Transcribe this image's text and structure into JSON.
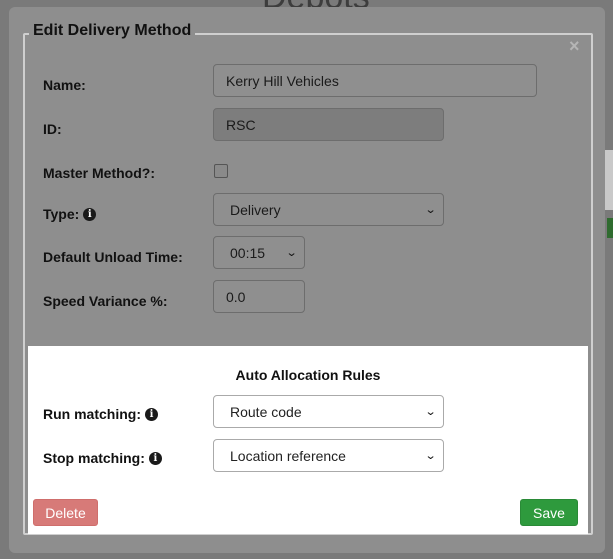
{
  "background": {
    "page_title": "Depots"
  },
  "dialog": {
    "title": "Edit Delivery Method",
    "close_glyph": "×",
    "fields": {
      "name": {
        "label": "Name:",
        "value": "Kerry Hill Vehicles"
      },
      "id": {
        "label": "ID:",
        "value": "RSC"
      },
      "master": {
        "label": "Master Method?:",
        "checked": false
      },
      "type": {
        "label": "Type:",
        "value": "Delivery"
      },
      "unload": {
        "label": "Default Unload Time:",
        "value": "00:15"
      },
      "speed": {
        "label": "Speed Variance %:",
        "value": "0.0"
      }
    },
    "auto_allocation": {
      "title": "Auto Allocation Rules",
      "run_matching": {
        "label": "Run matching:",
        "value": "Route code"
      },
      "stop_matching": {
        "label": "Stop matching:",
        "value": "Location reference"
      }
    },
    "buttons": {
      "delete": "Delete",
      "save": "Save"
    }
  },
  "icons": {
    "info": "info-icon",
    "chevron": "chevron-down-icon",
    "close": "close-icon"
  },
  "colors": {
    "save": "#2e9a3d",
    "delete": "#d77a78",
    "overlay": "#7a7a7a"
  }
}
